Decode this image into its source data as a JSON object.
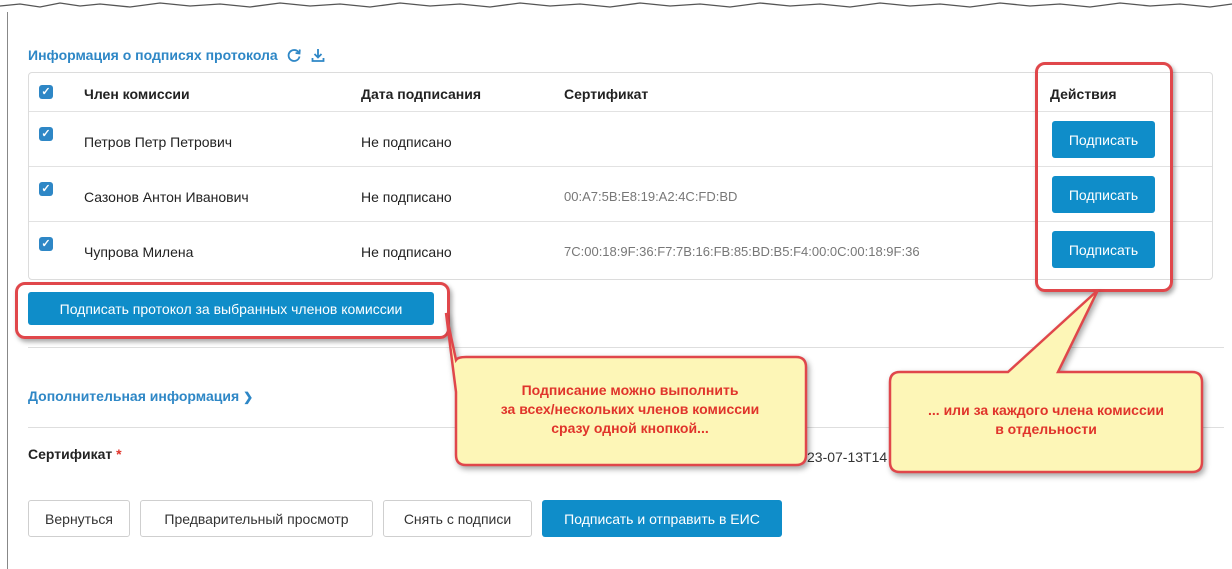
{
  "signatures_section": {
    "title": "Информация о подписях протокола",
    "refresh_icon": "refresh-icon",
    "download_icon": "download-icon",
    "table": {
      "columns": [
        "Член комиссии",
        "Дата подписания",
        "Сертификат",
        "Действия"
      ],
      "rows": [
        {
          "checked": true,
          "member": "Петров Петр Петрович",
          "date": "Не подписано",
          "certificate": "",
          "action": "Подписать"
        },
        {
          "checked": true,
          "member": "Сазонов Антон Иванович",
          "date": "Не подписано",
          "certificate": "00:A7:5B:E8:19:A2:4C:FD:BD",
          "action": "Подписать"
        },
        {
          "checked": true,
          "member": "Чупрова Милена",
          "date": "Не подписано",
          "certificate": "7C:00:18:9F:36:F7:7B:16:FB:85:BD:B5:F4:00:0C:00:18:9F:36",
          "action": "Подписать"
        }
      ]
    },
    "sign_selected_label": "Подписать протокол за выбранных членов комиссии"
  },
  "additional_info": {
    "label": "Дополнительная информация",
    "chevron_icon": "chevron-down-icon"
  },
  "certificate_field": {
    "label": "Сертификат",
    "required_mark": "*",
    "value": "23-07-13T14"
  },
  "footer_buttons": {
    "back": "Вернуться",
    "preview": "Предварительный просмотр",
    "unsign": "Снять с подписи",
    "sign_send": "Подписать и отправить в ЕИС"
  },
  "annotations": {
    "left_callout": [
      "Подписание можно выполнить",
      "за всех/нескольких членов комиссии",
      "сразу одной кнопкой..."
    ],
    "right_callout": [
      "... или за каждого члена комиссии",
      "в отдельности"
    ]
  },
  "colors": {
    "accent": "#2e87c6",
    "primary_button": "#0f8dc9",
    "highlight": "#e0474b",
    "callout_fill": "#fdf6b7",
    "callout_text": "#e0342b"
  }
}
